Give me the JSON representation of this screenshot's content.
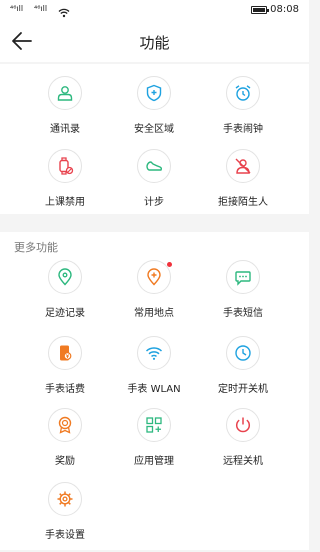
{
  "status": {
    "signal1": "⁴⁶ıll",
    "signal2": "⁴⁶ıll",
    "time": "08:08"
  },
  "header": {
    "title": "功能"
  },
  "main_features": [
    {
      "label": "通讯录",
      "icon": "contacts-icon",
      "color": "#2db87f"
    },
    {
      "label": "安全区域",
      "icon": "shield-icon",
      "color": "#1ea2e0"
    },
    {
      "label": "手表闹钟",
      "icon": "alarm-icon",
      "color": "#1ea2e0"
    },
    {
      "label": "上课禁用",
      "icon": "watch-ban-icon",
      "color": "#e8424d"
    },
    {
      "label": "计步",
      "icon": "shoe-icon",
      "color": "#2db87f"
    },
    {
      "label": "拒接陌生人",
      "icon": "person-block-icon",
      "color": "#e8424d"
    }
  ],
  "more_section": {
    "title": "更多功能",
    "items": [
      {
        "label": "足迹记录",
        "icon": "location-pin-icon",
        "color": "#2db87f"
      },
      {
        "label": "常用地点",
        "icon": "location-add-icon",
        "color": "#f07a22",
        "badge": true
      },
      {
        "label": "手表短信",
        "icon": "chat-icon",
        "color": "#2db87f"
      },
      {
        "label": "手表话费",
        "icon": "phone-fee-icon",
        "color": "#f07a22"
      },
      {
        "label": "手表 WLAN",
        "icon": "wifi-icon",
        "color": "#1ea2e0"
      },
      {
        "label": "定时开关机",
        "icon": "clock-icon",
        "color": "#1ea2e0"
      },
      {
        "label": "奖励",
        "icon": "medal-icon",
        "color": "#f07a22"
      },
      {
        "label": "应用管理",
        "icon": "apps-icon",
        "color": "#2db87f"
      },
      {
        "label": "远程关机",
        "icon": "power-icon",
        "color": "#e8424d"
      },
      {
        "label": "手表设置",
        "icon": "gear-icon",
        "color": "#f07a22"
      }
    ]
  }
}
